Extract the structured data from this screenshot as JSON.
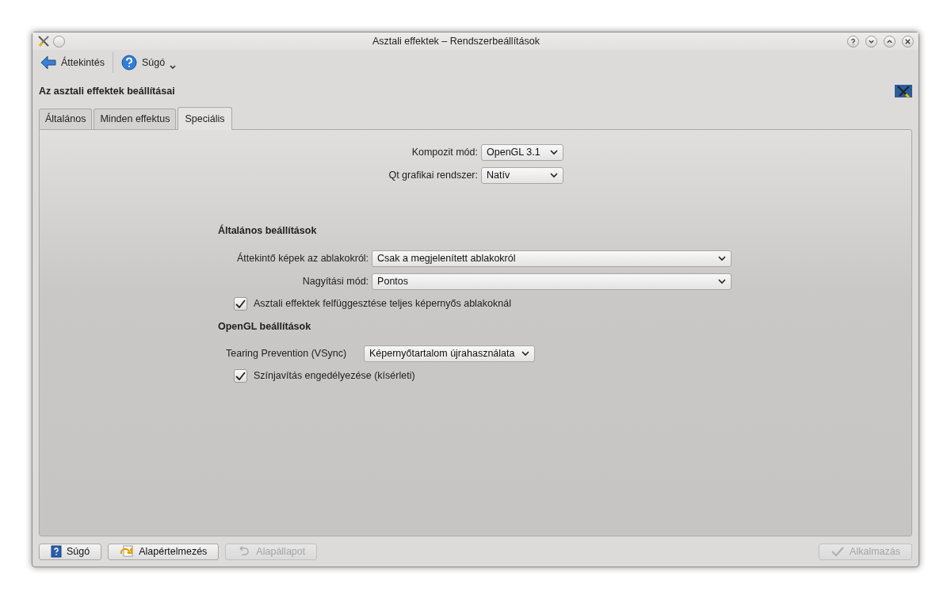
{
  "window": {
    "title": "Asztali effektek – Rendszerbeállítások"
  },
  "toolbar": [
    {
      "kind": "back",
      "label": "Áttekintés"
    },
    {
      "kind": "help",
      "label": "Súgó"
    }
  ],
  "heading": "Az asztali effektek beállításai",
  "tabs": [
    {
      "label": "Általános",
      "selected": false
    },
    {
      "label": "Minden effektus",
      "selected": false
    },
    {
      "label": "Speciális",
      "selected": true
    }
  ],
  "top_fields": [
    {
      "label": "Kompozit mód:",
      "value": "OpenGL 3.1"
    },
    {
      "label": "Qt grafikai rendszer:",
      "value": "Natív"
    }
  ],
  "sections": [
    {
      "title": "Általános beállítások",
      "rows": [
        {
          "kind": "combo",
          "label": "Áttekintő képek az ablakokról:",
          "value": "Csak a megjelenített ablakokról"
        },
        {
          "kind": "combo",
          "label": "Nagyítási mód:",
          "value": "Pontos"
        },
        {
          "kind": "check",
          "label": "Asztali effektek felfüggesztése teljes képernyős ablakoknál",
          "checked": true
        }
      ]
    },
    {
      "title": "OpenGL beállítások",
      "rows": [
        {
          "kind": "combo",
          "label": "Tearing Prevention (VSync)",
          "value": "Képernyőtartalom újrahasználata"
        },
        {
          "kind": "check",
          "label": "Színjavítás engedélyezése (kísérleti)",
          "checked": true
        }
      ]
    }
  ],
  "buttons": [
    {
      "kind": "help",
      "label": "Súgó",
      "disabled": false
    },
    {
      "kind": "defaults",
      "label": "Alapértelmezés",
      "disabled": false
    },
    {
      "kind": "reset",
      "label": "Alapállapot",
      "disabled": true
    },
    {
      "kind": "apply",
      "label": "Alkalmazás",
      "disabled": true
    }
  ]
}
